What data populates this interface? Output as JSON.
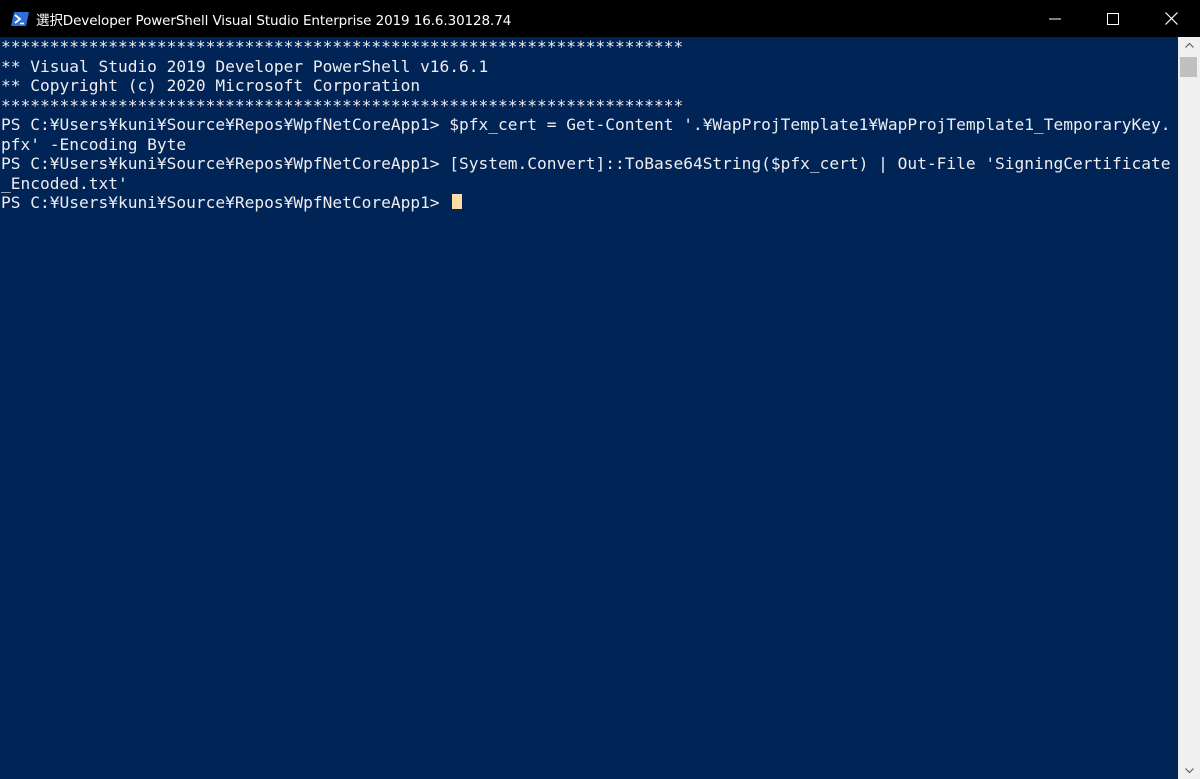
{
  "window": {
    "title": "選択Developer PowerShell Visual Studio Enterprise 2019 16.6.30128.74",
    "icon": "powershell-icon",
    "controls": [
      "minimize-icon",
      "maximize-icon",
      "close-icon"
    ]
  },
  "console": {
    "lines": [
      "**********************************************************************",
      "** Visual Studio 2019 Developer PowerShell v16.6.1",
      "** Copyright (c) 2020 Microsoft Corporation",
      "**********************************************************************",
      "PS C:¥Users¥kuni¥Source¥Repos¥WpfNetCoreApp1> $pfx_cert = Get-Content '.¥WapProjTemplate1¥WapProjTemplate1_TemporaryKey.",
      "pfx' -Encoding Byte",
      "PS C:¥Users¥kuni¥Source¥Repos¥WpfNetCoreApp1> [System.Convert]::ToBase64String($pfx_cert) | Out-File 'SigningCertificate",
      "_Encoded.txt'",
      "PS C:¥Users¥kuni¥Source¥Repos¥WpfNetCoreApp1> "
    ]
  },
  "colors": {
    "console_background": "#012456",
    "console_text": "#eeedf0",
    "cursor": "#fedba9",
    "titlebar": "#000000"
  }
}
